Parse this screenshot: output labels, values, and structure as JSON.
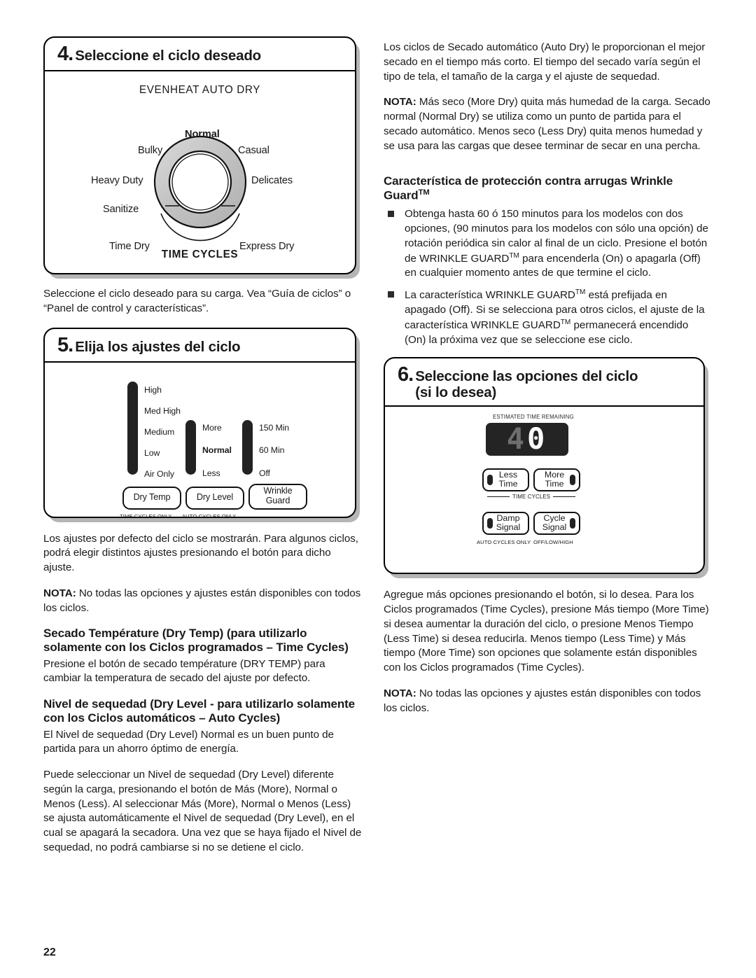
{
  "page": {
    "number": "22"
  },
  "step4": {
    "number": "4.",
    "title": "Seleccione el ciclo deseado",
    "dial": {
      "top_label": "EVENHEAT AUTO DRY",
      "bottom_label": "TIME CYCLES",
      "cycles": [
        {
          "label": "Normal",
          "bold": true
        },
        {
          "label": "Bulky",
          "bold": false
        },
        {
          "label": "Casual",
          "bold": false
        },
        {
          "label": "Heavy Duty",
          "bold": false
        },
        {
          "label": "Delicates",
          "bold": false
        },
        {
          "label": "Sanitize",
          "bold": false
        },
        {
          "label": "Time Dry",
          "bold": false
        },
        {
          "label": "Express Dry",
          "bold": false
        }
      ]
    },
    "caption": "Seleccione el ciclo deseado para su carga. Vea “Guía de ciclos” o “Panel de control y características”."
  },
  "step5": {
    "number": "5.",
    "title": "Elija los ajustes del ciclo",
    "sliders": [
      {
        "name": "dry-temp",
        "options": [
          {
            "label": "High",
            "bold": false
          },
          {
            "label": "Med High",
            "bold": false
          },
          {
            "label": "Medium",
            "bold": false
          },
          {
            "label": "Low",
            "bold": false
          },
          {
            "label": "Air Only",
            "bold": false
          }
        ]
      },
      {
        "name": "dry-level",
        "options": [
          {
            "label": "More",
            "bold": false
          },
          {
            "label": "Normal",
            "bold": true
          },
          {
            "label": "Less",
            "bold": false
          }
        ]
      },
      {
        "name": "wrinkle-guard",
        "options": [
          {
            "label": "150 Min",
            "bold": false
          },
          {
            "label": "60 Min",
            "bold": false
          },
          {
            "label": "Off",
            "bold": false
          }
        ]
      }
    ],
    "buttons": [
      {
        "name": "dry-temp",
        "label": "Dry Temp",
        "sub": "TIME CYCLES ONLY"
      },
      {
        "name": "dry-level",
        "label": "Dry Level",
        "sub": "AUTO CYCLES ONLY"
      },
      {
        "name": "wrinkle-guard",
        "line1": "Wrinkle",
        "line2": "Guard",
        "sub": ""
      }
    ],
    "p1": "Los ajustes por defecto del ciclo se mostrarán. Para algunos ciclos, podrá elegir distintos ajustes presionando el botón para dicho ajuste.",
    "nota_label": "NOTA:",
    "nota_text": " No todas las opciones y ajustes están disponibles con todos los ciclos.",
    "head_dry_temp": "Secado Température (Dry Temp) (para utilizarlo solamente con los Ciclos programados – Time Cycles)",
    "p_dry_temp": "Presione el botón de secado température (DRY TEMP) para cambiar la temperatura de secado del ajuste por defecto.",
    "head_dry_level": "Nivel de sequedad (Dry Level - para utilizarlo solamente con los Ciclos automáticos – Auto Cycles)",
    "p_dry_level_1": "El Nivel de sequedad (Dry Level) Normal es un buen punto de partida para un ahorro óptimo de energía.",
    "p_dry_level_2": "Puede seleccionar un Nivel de sequedad (Dry Level) diferente según la carga, presionando el botón de Más (More), Normal o Menos (Less). Al seleccionar Más (More), Normal o Menos (Less) se ajusta automáticamente el Nivel de sequedad (Dry Level), en el cual se apagará la secadora. Una vez que se haya fijado el Nivel de sequedad, no podrá cambiarse si no se detiene el ciclo."
  },
  "step6": {
    "number": "6.",
    "title_line1": "Seleccione las opciones del ciclo",
    "title_line2": "(si lo desea)",
    "display": {
      "label": "ESTIMATED TIME REMAINING",
      "digit1": "4",
      "digit2": "0",
      "value": "40"
    },
    "buttons_row1": [
      {
        "name": "less-time",
        "line1": "Less",
        "line2": "Time",
        "dot": "left"
      },
      {
        "name": "more-time",
        "line1": "More",
        "line2": "Time",
        "dot": "right"
      }
    ],
    "row1_rule_label": "TIME CYCLES",
    "buttons_row2": [
      {
        "name": "damp-signal",
        "line1": "Damp",
        "line2": "Signal",
        "dot": "left",
        "sub": "AUTO CYCLES ONLY"
      },
      {
        "name": "cycle-signal",
        "line1": "Cycle",
        "line2": "Signal",
        "dot": "right",
        "sub": "OFF/LOW/HIGH"
      }
    ],
    "p1": "Agregue más opciones presionando el botón, si lo desea. Para los Ciclos programados (Time Cycles), presione Más tiempo (More Time) si desea aumentar la duración del ciclo, o presione Menos Tiempo (Less Time) si desea reducirla. Menos tiempo (Less Time) y Más tiempo (More Time) son opciones que solamente están disponibles con los Ciclos programados (Time Cycles).",
    "nota_label": "NOTA:",
    "nota_text": " No todas las opciones y ajustes están disponibles con todos los ciclos."
  },
  "right_top": {
    "p1": "Los ciclos de Secado automático (Auto Dry) le proporcionan el mejor secado en el tiempo más corto. El tiempo del secado varía según el tipo de tela, el tamaño de la carga y el ajuste de sequedad.",
    "nota_label": "NOTA:",
    "nota_text": " Más seco (More Dry) quita más humedad de la carga. Secado normal (Normal Dry) se utiliza como un punto de partida para el secado automático. Menos seco (Less Dry) quita menos humedad y se usa para las cargas que desee terminar de secar en una percha.",
    "heading_a": "Característica de protección contra arrugas Wrinkle",
    "heading_b": "Guard",
    "heading_sup": "TM",
    "bullet1_a": "Obtenga hasta 60 ó 150 minutos para los modelos con dos opciones, (90 minutos para los modelos con sólo una opción) de rotación periódica sin calor al final de un ciclo. Presione el botón de WRINKLE GUARD",
    "bullet1_b": " para encenderla (On) o apagarla (Off) en cualquier momento antes de que termine el ciclo.",
    "bullet2_a": "La característica WRINKLE GUARD",
    "bullet2_b": " está prefijada en apagado (Off). Si se selecciona para otros ciclos, el ajuste de la característica WRINKLE GUARD",
    "bullet2_c": " permanecerá encendido (On) la próxima vez que se seleccione ese ciclo.",
    "sup": "TM"
  }
}
